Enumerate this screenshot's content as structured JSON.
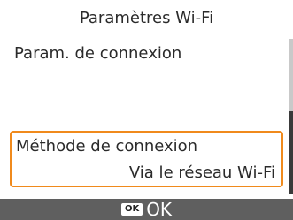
{
  "header": {
    "title": "Paramètres Wi-Fi"
  },
  "menu": {
    "items": [
      {
        "label": "Param. de connexion"
      },
      {
        "label": "Méthode de connexion",
        "value": "Via le réseau Wi-Fi",
        "selected": true
      }
    ]
  },
  "footer": {
    "key_label": "OK",
    "action_label": "OK"
  },
  "colors": {
    "accent": "#f08a1c",
    "footer_bg": "#5f5f5f"
  }
}
